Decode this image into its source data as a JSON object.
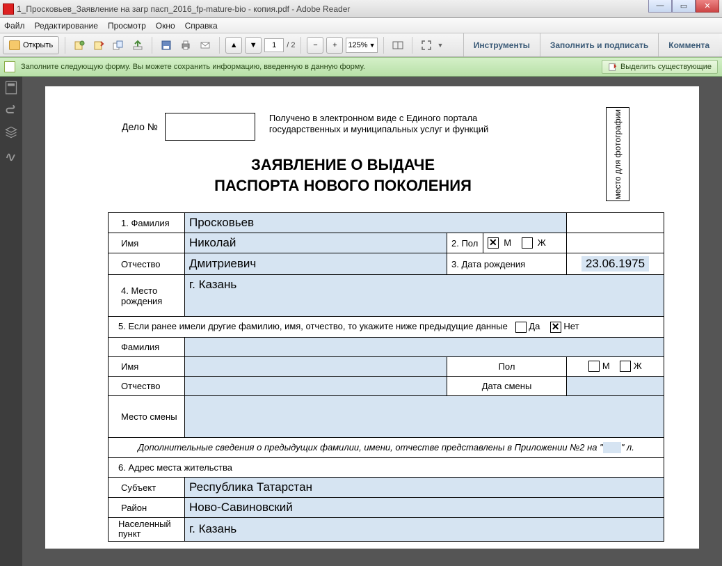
{
  "window": {
    "title": "1_Просковьев_Заявление на загр пасп_2016_fp-mature-bio - копия.pdf - Adobe Reader"
  },
  "menu": {
    "file": "Файл",
    "edit": "Редактирование",
    "view": "Просмотр",
    "window": "Окно",
    "help": "Справка"
  },
  "toolbar": {
    "open": "Открыть",
    "page_current": "1",
    "page_sep": "/ 2",
    "zoom": "125%",
    "tools": "Инструменты",
    "fill_sign": "Заполнить и подписать",
    "comment": "Коммента"
  },
  "infobar": {
    "text": "Заполните следующую форму. Вы можете сохранить информацию, введенную в данную форму.",
    "highlight_btn": "Выделить существующие"
  },
  "form": {
    "delo_label": "Дело №",
    "portal_text_1": "Получено в электронном виде с Единого портала",
    "portal_text_2": "государственных и муниципальных услуг и функций",
    "photo_placeholder": "место для фотографии",
    "title_1": "ЗАЯВЛЕНИЕ О ВЫДАЧЕ",
    "title_2": "ПАСПОРТА НОВОГО ПОКОЛЕНИЯ",
    "labels": {
      "surname": "1. Фамилия",
      "name": "Имя",
      "patronymic": "Отчество",
      "sex": "2. Пол",
      "m": "М",
      "f": "Ж",
      "dob": "3. Дата рождения",
      "birthplace": "4. Место рождения",
      "former_names": "5. Если ранее имели другие фамилию, имя, отчество, то укажите ниже предыдущие данные",
      "yes": "Да",
      "no": "Нет",
      "prev_surname": "Фамилия",
      "prev_name": "Имя",
      "prev_patr": "Отчество",
      "prev_sex": "Пол",
      "prev_date": "Дата смены",
      "prev_place": "Место смены",
      "appendix": "Дополнительные сведения о предыдущих фамилии, имени, отчестве представлены в Приложении №2 на \"",
      "appendix_end": "\" л.",
      "address_header": "6. Адрес места жительства",
      "subject": "Субъект",
      "district": "Район",
      "locality": "Населенный пункт"
    },
    "values": {
      "surname": "Просковьев",
      "name": "Николай",
      "patronymic": "Дмитриевич",
      "dob": "23.06.1975",
      "birthplace": "г. Казань",
      "subject": "Республика Татарстан",
      "district": "Ново-Савиновский",
      "locality": "г. Казань"
    },
    "checks": {
      "sex_m": true,
      "sex_f": false,
      "former_yes": false,
      "former_no": true,
      "prev_m": false,
      "prev_f": false
    }
  }
}
